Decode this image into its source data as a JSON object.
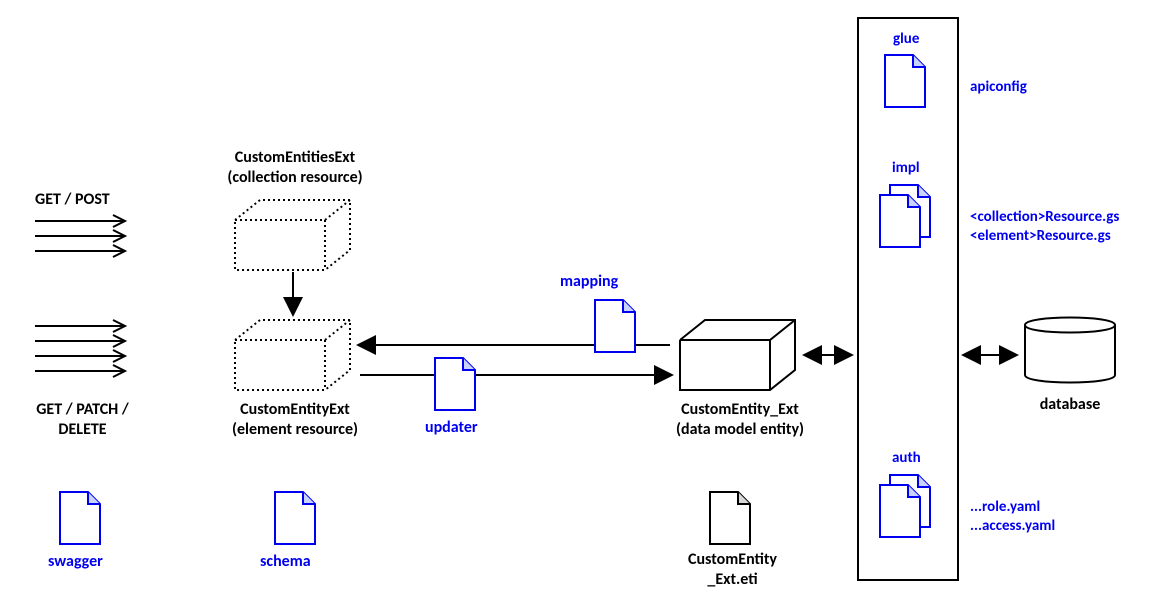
{
  "labels": {
    "get_post": "GET / POST",
    "get_patch_delete": "GET / PATCH /\nDELETE",
    "swagger": "swagger",
    "schema": "schema",
    "collection_title": "CustomEntitiesExt\n(collection resource)",
    "element_title": "CustomEntityExt\n(element resource)",
    "mapping": "mapping",
    "updater": "updater",
    "entity_title": "CustomEntity_Ext\n(data model entity)",
    "entity_file": "CustomEntity\n_Ext.eti",
    "database": "database",
    "glue": "glue",
    "apiconfig": "apiconfig",
    "impl": "impl",
    "impl_files": "<collection>Resource.gs\n<element>Resource.gs",
    "auth": "auth",
    "auth_files": "...role.yaml\n...access.yaml"
  }
}
